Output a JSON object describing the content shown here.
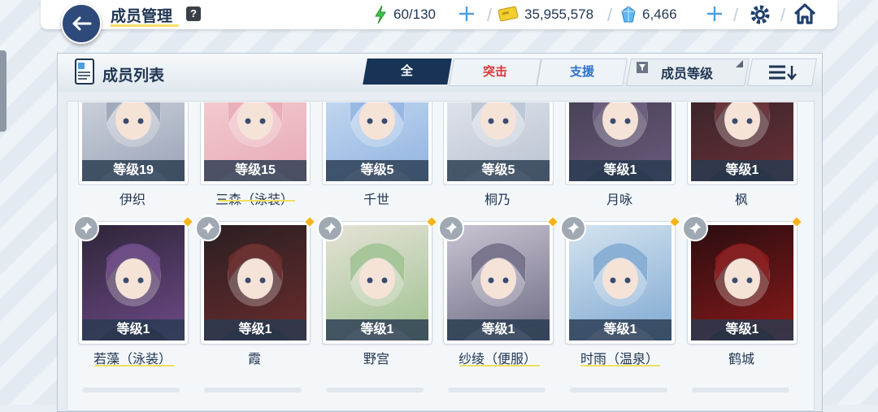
{
  "header": {
    "title": "成员管理",
    "help": "?",
    "stamina": "60/130",
    "credits": "35,955,578",
    "gems": "6,466",
    "plus": "+"
  },
  "panel": {
    "title": "成员列表",
    "tabs": {
      "all": "全",
      "strike": "突击",
      "support": "支援"
    },
    "sort_label": "成员等级"
  },
  "row1": [
    {
      "level": "等级19",
      "name": "伊织"
    },
    {
      "level": "等级15",
      "name": "三森（泳装）"
    },
    {
      "level": "等级5",
      "name": "千世"
    },
    {
      "level": "等级5",
      "name": "桐乃"
    },
    {
      "level": "等级1",
      "name": "月咏"
    },
    {
      "level": "等级1",
      "name": "枫"
    }
  ],
  "row2": [
    {
      "level": "等级1",
      "name": "若藻（泳装）"
    },
    {
      "level": "等级1",
      "name": "霞"
    },
    {
      "level": "等级1",
      "name": "野宫"
    },
    {
      "level": "等级1",
      "name": "纱绫（便服）"
    },
    {
      "level": "等级1",
      "name": "时雨（温泉）"
    },
    {
      "level": "等级1",
      "name": "鹤城"
    }
  ],
  "colors": {
    "accent": "#173457",
    "strike": "#d83a3a",
    "support": "#2d72c9",
    "highlight": "#f0de5e"
  }
}
